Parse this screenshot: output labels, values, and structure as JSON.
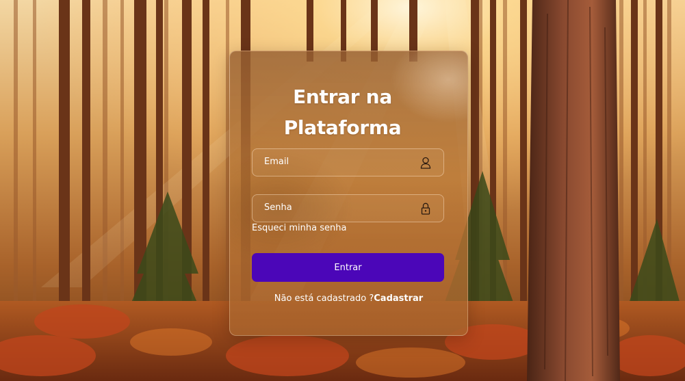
{
  "login": {
    "title_line1": "Entrar na",
    "title_line2": "Plataforma",
    "email_placeholder": "Email",
    "password_placeholder": "Senha",
    "forgot_password": "Esqueci minha senha",
    "submit_label": "Entrar",
    "signup_prompt": "Não está cadastrado ?",
    "signup_link": "Cadastrar"
  },
  "icons": {
    "email": "user-icon",
    "password": "lock-icon"
  },
  "colors": {
    "accent": "#4b06b8",
    "text": "#ffffff"
  }
}
